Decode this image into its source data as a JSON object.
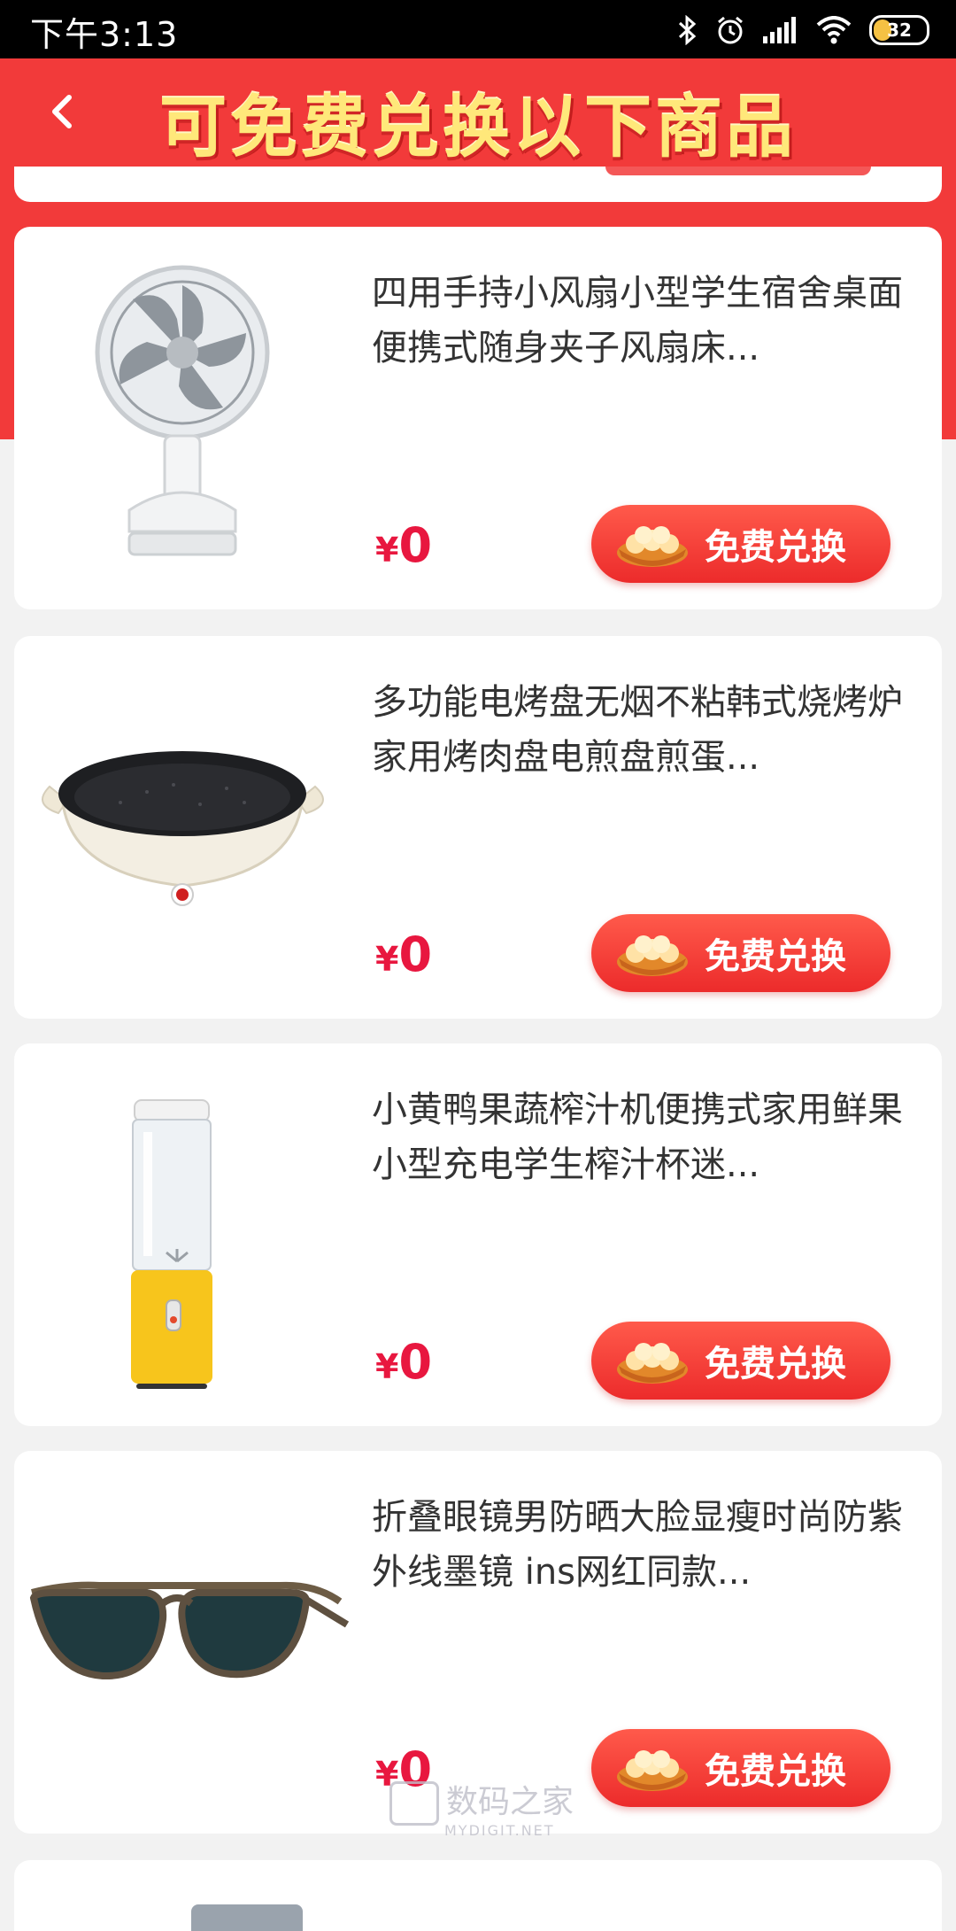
{
  "status_bar": {
    "time": "下午3:13",
    "battery": "32"
  },
  "header": {
    "title": "可免费兑换以下商品"
  },
  "products": [
    {
      "title": "四用手持小风扇小型学生宿舍桌面便携式随身夹子风扇床...",
      "currency": "¥",
      "price": "0",
      "button_label": "免费兑换",
      "image": "clip-fan"
    },
    {
      "title": "多功能电烤盘无烟不粘韩式烧烤炉家用烤肉盘电煎盘煎蛋...",
      "currency": "¥",
      "price": "0",
      "button_label": "免费兑换",
      "image": "electric-grill-pan"
    },
    {
      "title": "小黄鸭果蔬榨汁机便携式家用鲜果小型充电学生榨汁杯迷...",
      "currency": "¥",
      "price": "0",
      "button_label": "免费兑换",
      "image": "portable-juicer"
    },
    {
      "title": "折叠眼镜男防晒大脸显瘦时尚防紫外线墨镜 ins网红同款...",
      "currency": "¥",
      "price": "0",
      "button_label": "免费兑换",
      "image": "folding-sunglasses"
    }
  ],
  "watermark": {
    "text": "数码之家",
    "sub": "MYDIGIT.NET"
  },
  "colors": {
    "header_red": "#f23a3a",
    "title_yellow": "#ffe87a",
    "price_red": "#e8173f",
    "button_red": "#ec2b2b"
  }
}
